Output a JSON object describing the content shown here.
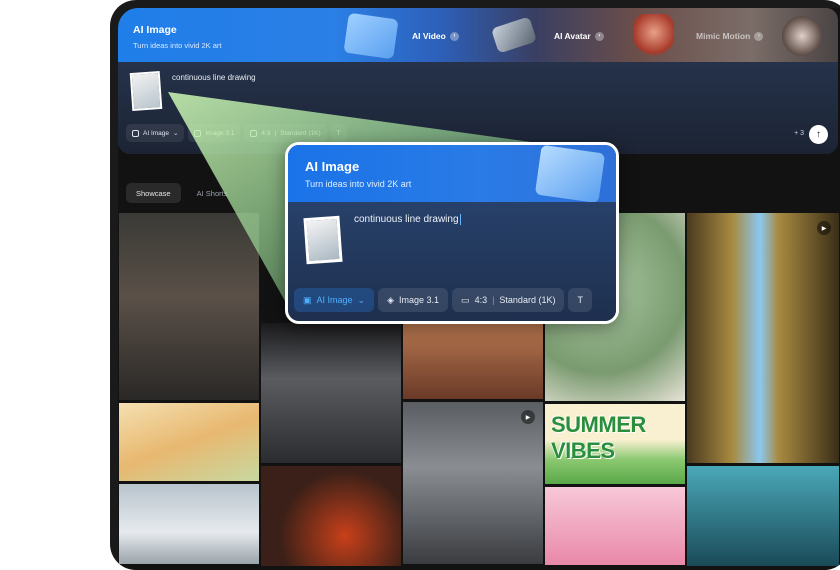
{
  "banner": {
    "ai_image_title": "AI Image",
    "ai_image_subtitle": "Turn ideas into vivid 2K art",
    "tabs": [
      {
        "label": "AI Video"
      },
      {
        "label": "AI Avatar"
      },
      {
        "label": "Mimic Motion"
      }
    ]
  },
  "prompt": {
    "text": "continuous line drawing",
    "chips": {
      "mode": "AI Image",
      "model": "Image 3.1",
      "ratio": "4:3",
      "quality": "Standard (1K)"
    },
    "credits": "+ 3"
  },
  "filters": {
    "showcase": "Showcase",
    "shorts": "AI Shorts"
  },
  "gallery": {
    "summer_text": "SUMMER VIBES"
  },
  "zoom": {
    "title": "AI Image",
    "subtitle": "Turn ideas into vivid 2K art",
    "prompt": "continuous line drawing",
    "chips": {
      "mode": "AI Image",
      "model": "Image 3.1",
      "ratio": "4:3",
      "quality": "Standard (1K)"
    }
  },
  "colors": {
    "accent": "#1f7ee8",
    "accent_chip": "#4fb0ff"
  }
}
